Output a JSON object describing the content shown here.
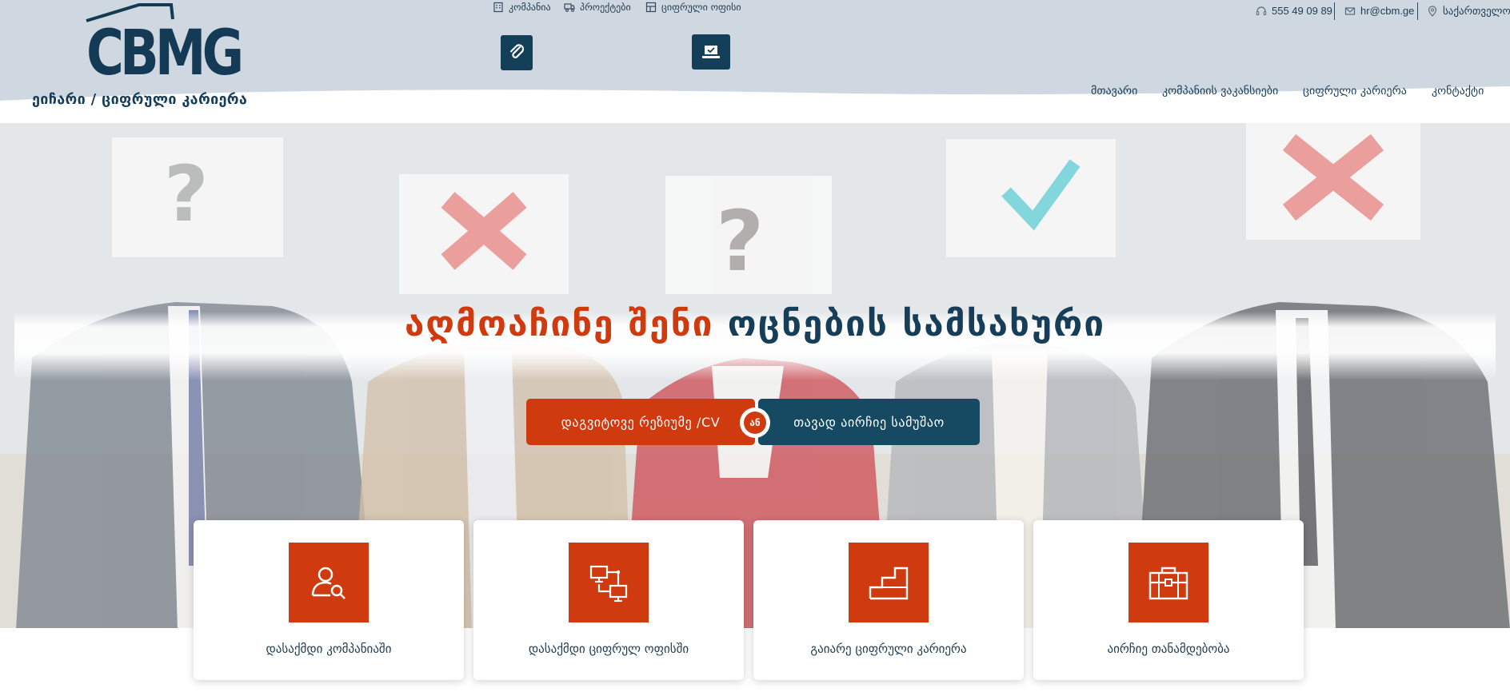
{
  "logo": {
    "text": "CBMG"
  },
  "breadcrumb": "ეიჩარი / ციფრული კარიერა",
  "topnav": {
    "items": [
      {
        "label": "კომპანია",
        "icon": "building-icon"
      },
      {
        "label": "პროექტები",
        "icon": "truck-icon"
      },
      {
        "label": "ციფრული ოფისი",
        "icon": "office-icon"
      }
    ]
  },
  "quick_icons": [
    {
      "icon": "paperclip-icon"
    },
    {
      "icon": "laptop-check-icon"
    }
  ],
  "contact": {
    "phone": "555 49 09 89",
    "email": "hr@cbm.ge",
    "location": "საქართველო"
  },
  "mainnav": {
    "items": [
      {
        "label": "მთავარი"
      },
      {
        "label": "კომპანიის ვაკანსიები"
      },
      {
        "label": "ციფრული კარიერა"
      },
      {
        "label": "კონტაქტი"
      }
    ]
  },
  "hero": {
    "headline_part1": "აღმოაჩინე შენი",
    "headline_part2": "ოცნების სამსახური",
    "cta_left": "დაგვიტოვე რეზიუმე /CV",
    "or_label": "ან",
    "cta_right": "თავად აირჩიე სამუშაო"
  },
  "cards": [
    {
      "label": "დასაქმდი კომპანიაში",
      "icon": "user-search-icon"
    },
    {
      "label": "დასაქმდი ციფრულ ოფისში",
      "icon": "network-monitors-icon"
    },
    {
      "label": "გაიარე ციფრული კარიერა",
      "icon": "steps-icon"
    },
    {
      "label": "აირჩიე თანამდებობა",
      "icon": "briefcase-icon"
    }
  ],
  "colors": {
    "accent": "#cf3a0e",
    "brand_dark": "#143f58",
    "header_bg": "#cfd7e0"
  }
}
